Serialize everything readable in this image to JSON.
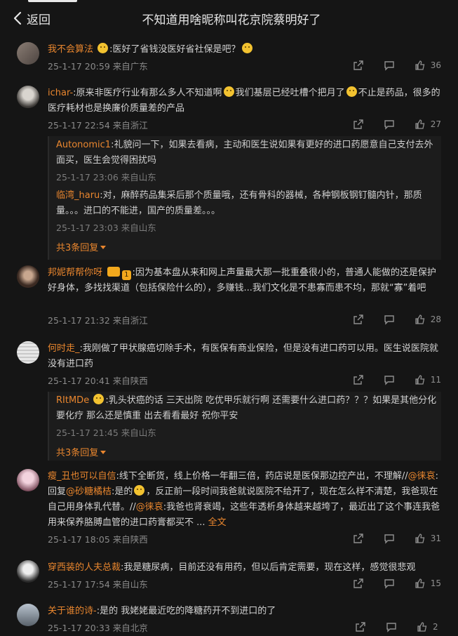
{
  "header": {
    "back_label": "返回",
    "title": "不知道用啥昵称叫花京院蔡明好了"
  },
  "comments": [
    {
      "name": "我不会算法",
      "text": ":医好了省钱没医好省社保是吧？",
      "time": "25-1-17 20:59",
      "location": "来自广东",
      "likes": "36"
    },
    {
      "name": "ichar-",
      "text": ":原来非医疗行业有那么多人不知道啊",
      "text2": "我们基层已经吐槽个把月了",
      "text3": "不止是药品，很多的医疗耗材也是换廉价质量差的产品",
      "time": "25-1-17 22:54",
      "location": "来自浙江",
      "likes": "27",
      "replies": [
        {
          "name": "Autonomic1",
          "text": ":礼貌问一下，如果去看病，主动和医生说如果有更好的进口药愿意自己支付去外面买，医生会觉得困扰吗",
          "time": "25-1-17 23:06",
          "location": "来自山东"
        },
        {
          "name": "临湾_haru",
          "text": ":对，麻醉药品集采后那个质量哦，还有骨科的器械，各种钢板钢钉髓内针，那质量。。。进口的不能进，国产的质量差。。。",
          "time": "25-1-17 23:03",
          "location": "来自山东"
        }
      ],
      "more": "共3条回复"
    },
    {
      "name": "邦妮帮帮你呀",
      "badge_level": "1",
      "text": ":因为基本盘从来和网上声量最大那一批重叠很小的，普通人能做的还是保护好身体，多找找渠道（包括保险什么的），多赚钱...我们文化是不患寡而患不均，那就“寡”着吧",
      "time": "25-1-17 21:32",
      "location": "来自浙江",
      "likes": "28"
    },
    {
      "name": "何时走_",
      "text": ":我刚做了甲状腺癌切除手术，有医保有商业保险，但是没有进口药可以用。医生说医院就没有进口药",
      "time": "25-1-17 20:41",
      "location": "来自陕西",
      "likes": "11",
      "replies": [
        {
          "name": "RItMDe",
          "text": ":乳头状癌的话 三天出院 吃优甲乐就行啊 还需要什么进口药？？？如果是其他分化要化疗 那么还是慎重 出去看看最好 祝你平安",
          "time": "25-1-17 21:45",
          "location": "来自山东"
        }
      ],
      "more": "共3条回复"
    },
    {
      "name": "瘦_丑也可以自信",
      "text": ":线下全断货，线上价格一年翻三倍，药店说是医保那边控产出，不理解//",
      "mention1": "@徕哀",
      "text_b": ":回复",
      "mention2": "@砂糖橘桔",
      "text_c": ":是的",
      "text_d": "，反正前一段时间我爸就说医院不给开了，现在怎么样不清楚，我爸现在自己用身体乳代替。//",
      "mention3": "@徕哀",
      "text_e": ":我爸也肾衰竭，这些年透析身体越来越垮了，最近出了这个事连我爸用来保养胳膊血管的进口药膏都买不 ...",
      "full_text": "全文",
      "time": "25-1-17 18:05",
      "location": "来自陕西",
      "likes": "31"
    },
    {
      "name": "穿西装的人夫总裁",
      "text": ":我是糖尿病，目前还没有用药，但以后肯定需要，现在这样，感觉很悲观",
      "time": "25-1-17 17:54",
      "location": "来自山东",
      "likes": "15"
    },
    {
      "name": "关于谁的诗-",
      "text": ":是的 我姥姥最近吃的降糖药开不到进口的了",
      "time": "25-1-17 20:33",
      "location": "来自北京",
      "likes": "2"
    }
  ]
}
